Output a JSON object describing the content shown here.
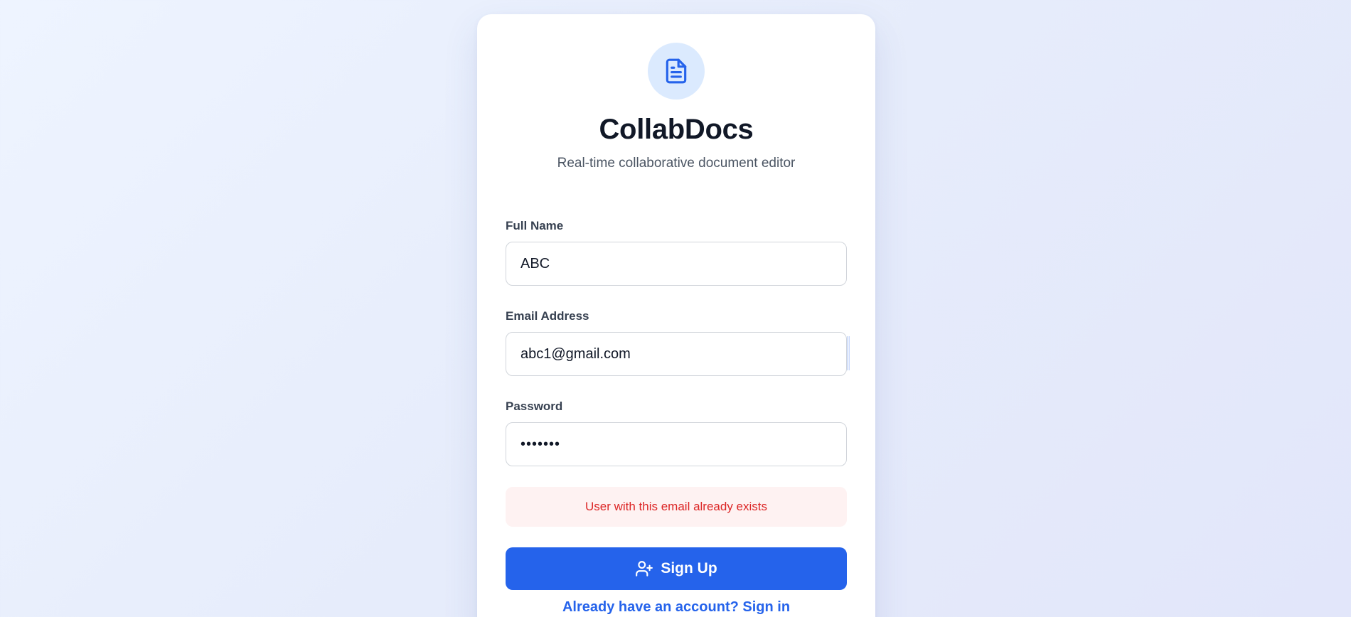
{
  "app": {
    "title": "CollabDocs",
    "subtitle": "Real-time collaborative document editor",
    "logo_icon": "document-icon"
  },
  "form": {
    "full_name": {
      "label": "Full Name",
      "value": "ABC"
    },
    "email": {
      "label": "Email Address",
      "value": "abc1@gmail.com"
    },
    "password": {
      "label": "Password",
      "value": "•••••••"
    },
    "error": "User with this email already exists",
    "submit_label": "Sign Up",
    "submit_icon": "user-plus-icon",
    "signin_link": "Already have an account? Sign in"
  },
  "colors": {
    "accent": "#2563eb",
    "logo_bg": "#dbeafe",
    "error_text": "#dc2626",
    "error_bg": "#fef2f2"
  }
}
